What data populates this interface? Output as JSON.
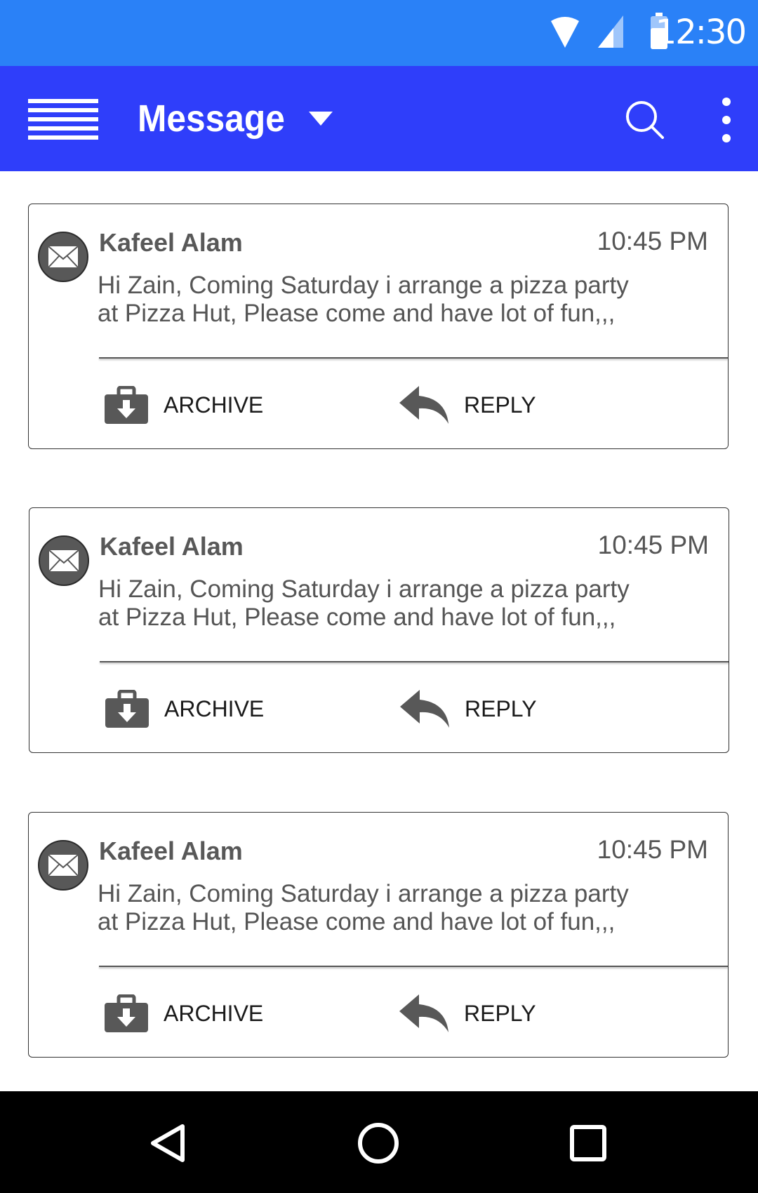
{
  "status_bar": {
    "time": "12:30",
    "icons": [
      "wifi-icon",
      "cell-signal-icon",
      "battery-icon"
    ],
    "background": "#2A81F7"
  },
  "app_bar": {
    "title": "Message",
    "background": "#2F3EFA",
    "icons": [
      "hamburger-menu-icon",
      "caret-down-icon",
      "search-icon",
      "more-vert-icon"
    ]
  },
  "messages": [
    {
      "sender": "Kafeel Alam",
      "time": "10:45 PM",
      "line1": "Hi Zain, Coming Saturday i arrange a pizza party",
      "line2": "at Pizza Hut, Please come and have lot of fun,,,",
      "archive_label": "ARCHIVE",
      "reply_label": "REPLY"
    },
    {
      "sender": "Kafeel Alam",
      "time": "10:45 PM",
      "line1": "Hi Zain, Coming Saturday i arrange a pizza party",
      "line2": "at Pizza Hut, Please come and have lot of fun,,,",
      "archive_label": "ARCHIVE",
      "reply_label": "REPLY"
    },
    {
      "sender": "Kafeel Alam",
      "time": "10:45 PM",
      "line1": "Hi Zain, Coming Saturday i arrange a pizza party",
      "line2": "at Pizza Hut, Please come and have lot of fun,,,",
      "archive_label": "ARCHIVE",
      "reply_label": "REPLY"
    }
  ],
  "nav_bar": {
    "icons": [
      "back-icon",
      "home-icon",
      "recents-icon"
    ]
  }
}
